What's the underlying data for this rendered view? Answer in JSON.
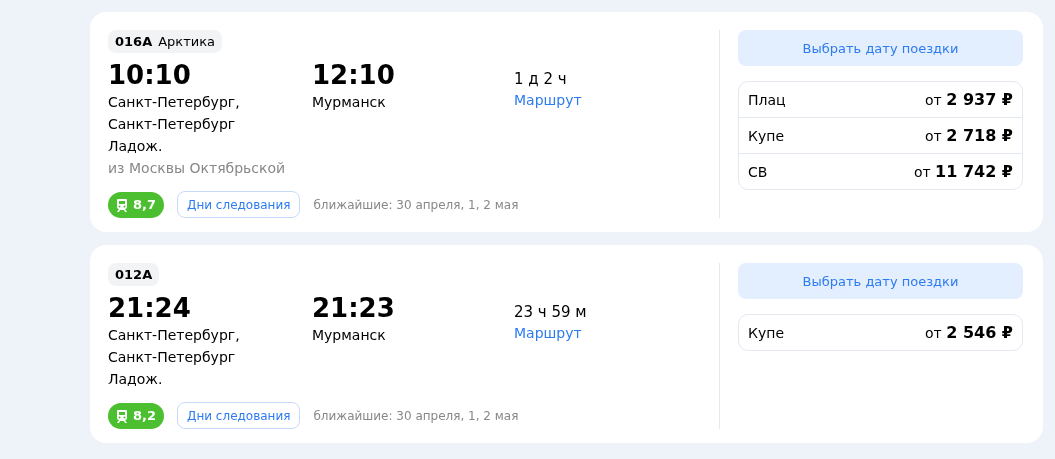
{
  "trains": [
    {
      "number": "016А",
      "name": "Арктика",
      "departure": {
        "time": "10:10",
        "station": "Санкт-Петербург, Санкт-Петербург Ладож.",
        "note": "из Москвы Октябрьской"
      },
      "arrival": {
        "time": "12:10",
        "station": "Мурманск"
      },
      "duration": "1 д 2 ч",
      "route_link": "Маршрут",
      "rating": "8,7",
      "schedule_button": "Дни следования",
      "nearest": "ближайшие: 30 апреля, 1, 2 мая",
      "date_button": "Выбрать дату поездки",
      "classes": [
        {
          "name": "Плац",
          "price": "от **2 937 ₽**"
        },
        {
          "name": "Купе",
          "price": "от **2 718 ₽**"
        },
        {
          "name": "СВ",
          "price": "от **11 742 ₽**"
        }
      ]
    },
    {
      "number": "012А",
      "departure": {
        "time": "21:24",
        "station": "Санкт-Петербург, Санкт-Петербург Ладож."
      },
      "arrival": {
        "time": "21:23",
        "station": "Мурманск"
      },
      "duration": "23 ч 59 м",
      "route_link": "Маршрут",
      "rating": "8,2",
      "schedule_button": "Дни следования",
      "nearest": "ближайшие: 30 апреля, 1, 2 мая",
      "date_button": "Выбрать дату поездки",
      "classes": [
        {
          "name": "Купе",
          "price": "от **2 546 ₽**"
        }
      ]
    }
  ]
}
